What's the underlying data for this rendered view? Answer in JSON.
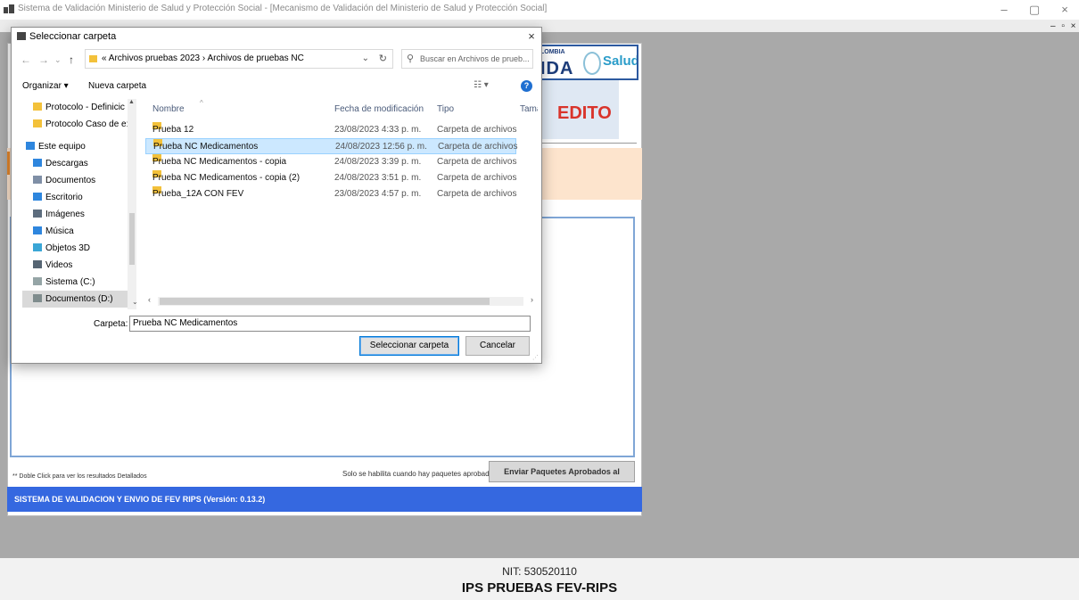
{
  "window": {
    "title": "Sistema de Validación Ministerio de Salud y Protección Social - [Mecanismo de Validación del Ministerio de Salud y Protección Social]",
    "minimize": "–",
    "maximize": "▢",
    "close": "×",
    "mdi_controls": "– ▫ ×"
  },
  "dialog": {
    "title": "Seleccionar carpeta",
    "close": "×",
    "nav": {
      "back": "←",
      "forward": "→",
      "recent": "⌄",
      "up": "↑"
    },
    "address": {
      "prefix": "«",
      "path": [
        "Archivos pruebas 2023",
        "Archivos de pruebas NC"
      ],
      "separator": "›",
      "dropdown": "⌄",
      "refresh": "↻"
    },
    "search_placeholder": "Buscar en Archivos de prueb...",
    "toolbar": {
      "organize": "Organizar ▾",
      "new_folder": "Nueva carpeta",
      "view": "☷ ▾",
      "help": "?"
    },
    "nav_pane": [
      {
        "label": "Protocolo - Definicic",
        "icon": "folder-icon",
        "color": "#f3c13a"
      },
      {
        "label": "Protocolo Caso de e:",
        "icon": "folder-icon",
        "color": "#f3c13a"
      },
      {
        "label": "Este equipo",
        "icon": "computer-icon",
        "color": "#2e86de"
      },
      {
        "label": "Descargas",
        "icon": "download-icon",
        "color": "#2e86de"
      },
      {
        "label": "Documentos",
        "icon": "documents-icon",
        "color": "#7f8fa6"
      },
      {
        "label": "Escritorio",
        "icon": "desktop-icon",
        "color": "#2e86de"
      },
      {
        "label": "Imágenes",
        "icon": "pictures-icon",
        "color": "#5d6d7e"
      },
      {
        "label": "Música",
        "icon": "music-icon",
        "color": "#2e86de"
      },
      {
        "label": "Objetos 3D",
        "icon": "3d-objects-icon",
        "color": "#3aa6d6"
      },
      {
        "label": "Videos",
        "icon": "videos-icon",
        "color": "#566573"
      },
      {
        "label": "Sistema (C:)",
        "icon": "drive-icon",
        "color": "#95a5a6"
      },
      {
        "label": "Documentos (D:)",
        "icon": "drive-icon",
        "color": "#7f8c8d"
      }
    ],
    "columns": {
      "name": "Nombre",
      "date": "Fecha de modificación",
      "type": "Tipo",
      "size": "Tama"
    },
    "files": [
      {
        "name": "Prueba 12",
        "date": "23/08/2023 4:33 p. m.",
        "type": "Carpeta de archivos"
      },
      {
        "name": "Prueba NC Medicamentos",
        "date": "24/08/2023 12:56 p. m.",
        "type": "Carpeta de archivos"
      },
      {
        "name": "Prueba NC Medicamentos - copia",
        "date": "24/08/2023 3:39 p. m.",
        "type": "Carpeta de archivos"
      },
      {
        "name": "Prueba NC Medicamentos - copia (2)",
        "date": "24/08/2023 3:51 p. m.",
        "type": "Carpeta de archivos"
      },
      {
        "name": "Prueba_12A CON FEV",
        "date": "23/08/2023 4:57 p. m.",
        "type": "Carpeta de archivos"
      }
    ],
    "folder_label": "Carpeta:",
    "folder_value": "Prueba NC Medicamentos",
    "select_button": "Seleccionar carpeta",
    "cancel_button": "Cancelar"
  },
  "background_form": {
    "logo_top": "LOMBIA",
    "logo_big": "IDA",
    "logo_salud": "Salud",
    "credito": "EDITO",
    "hint": "** Doble Click para ver los resultados Detallados",
    "only_when": "Solo se habilita cuando hay paquetes aprobados",
    "send_button": "Enviar Paquetes Aprobados al",
    "status": "SISTEMA DE VALIDACION Y ENVIO DE FEV RIPS  (Versión: 0.13.2)"
  },
  "footer": {
    "nit": "NIT: 530520110",
    "company": "IPS PRUEBAS FEV-RIPS"
  },
  "colors": {
    "status_bar": "#3568e0",
    "selection": "#cce8ff",
    "credito": "#d9342b"
  }
}
